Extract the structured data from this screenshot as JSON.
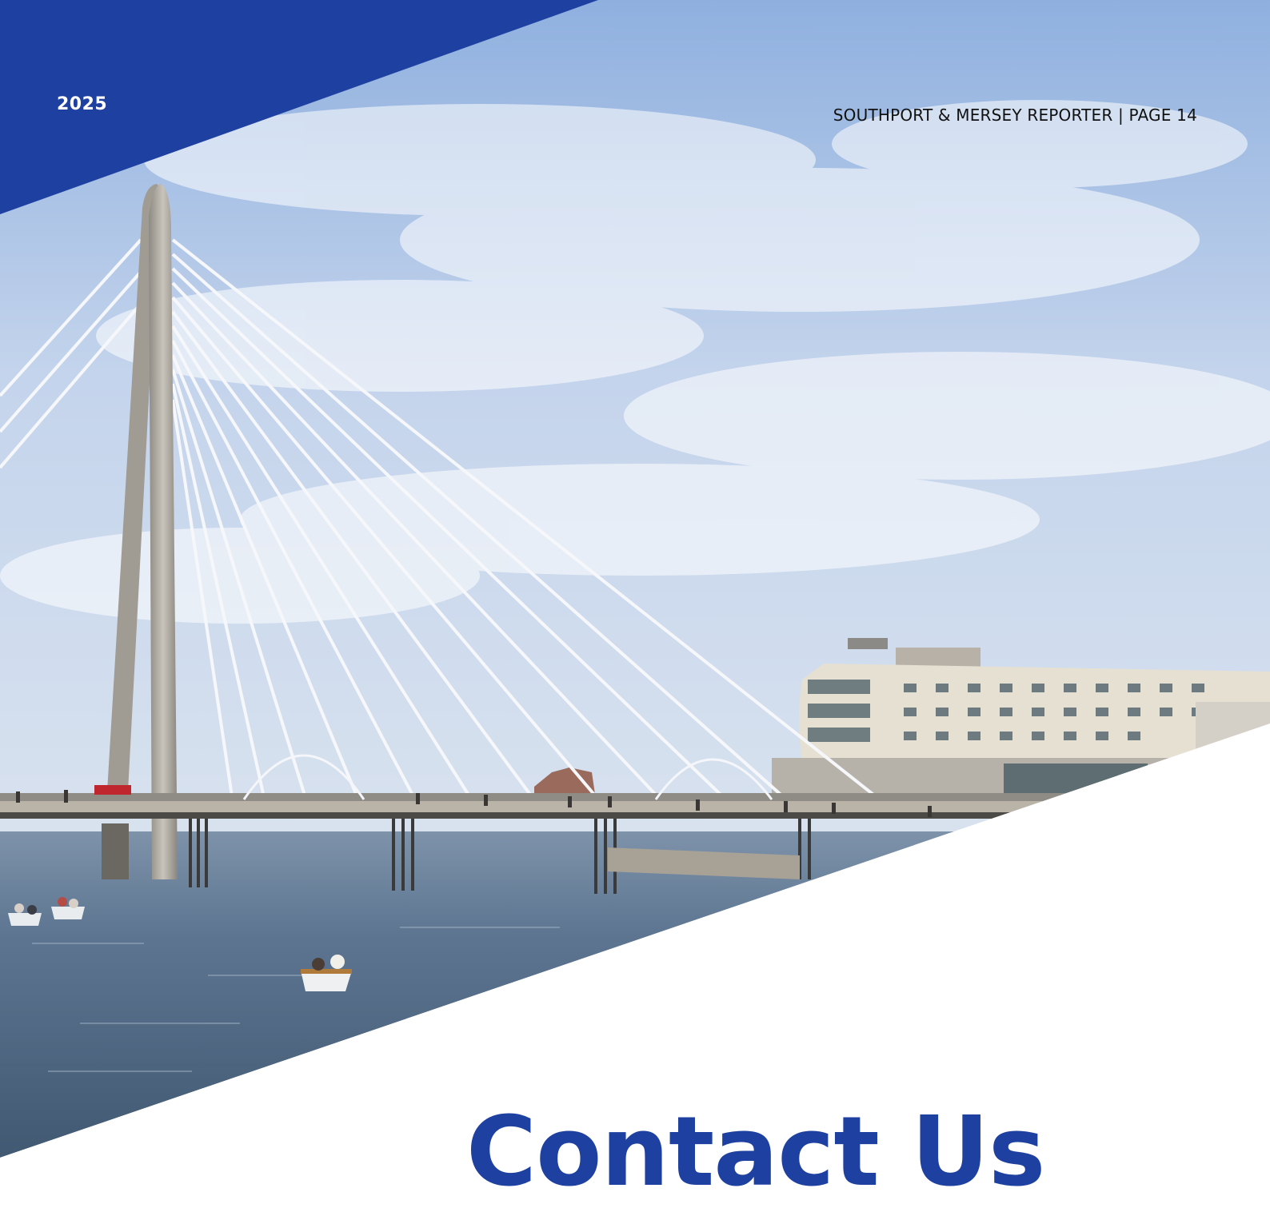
{
  "header": {
    "year": "2025",
    "running_head": "SOUTHPORT & MERSEY REPORTER | PAGE 14"
  },
  "main": {
    "heading": "Contact Us"
  },
  "colors": {
    "brand_blue": "#1e40a0",
    "heading_blue": "#1e40a0",
    "sky": "#b8cde8",
    "water": "#4d6580",
    "white": "#ffffff"
  },
  "photo": {
    "subject": "cable-stayed pier bridge over water with hotel and small boats"
  }
}
